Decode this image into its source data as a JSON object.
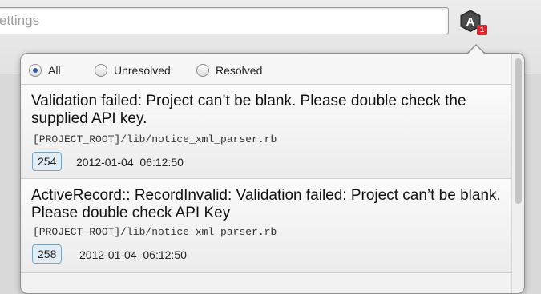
{
  "search": {
    "placeholder": "ettings"
  },
  "app_icon": {
    "name": "a-hexagon-icon",
    "badge_count": "1",
    "badge_color": "#e0262c"
  },
  "filters": {
    "options": [
      {
        "label": "All",
        "checked": true
      },
      {
        "label": "Unresolved",
        "checked": false
      },
      {
        "label": "Resolved",
        "checked": false
      }
    ]
  },
  "errors": [
    {
      "title": "Validation failed: Project can’t be blank. Please double check the supplied API key.",
      "path": "[PROJECT_ROOT]/lib/notice_xml_parser.rb",
      "count": "254",
      "timestamp": "2012-01-04  06:12:50"
    },
    {
      "title": "ActiveRecord:: RecordInvalid: Validation failed: Project can’t be blank. Please double check API Key",
      "path": "[PROJECT_ROOT]/lib/notice_xml_parser.rb",
      "count": "258",
      "timestamp": "2012-01-04  06:12:50"
    }
  ]
}
